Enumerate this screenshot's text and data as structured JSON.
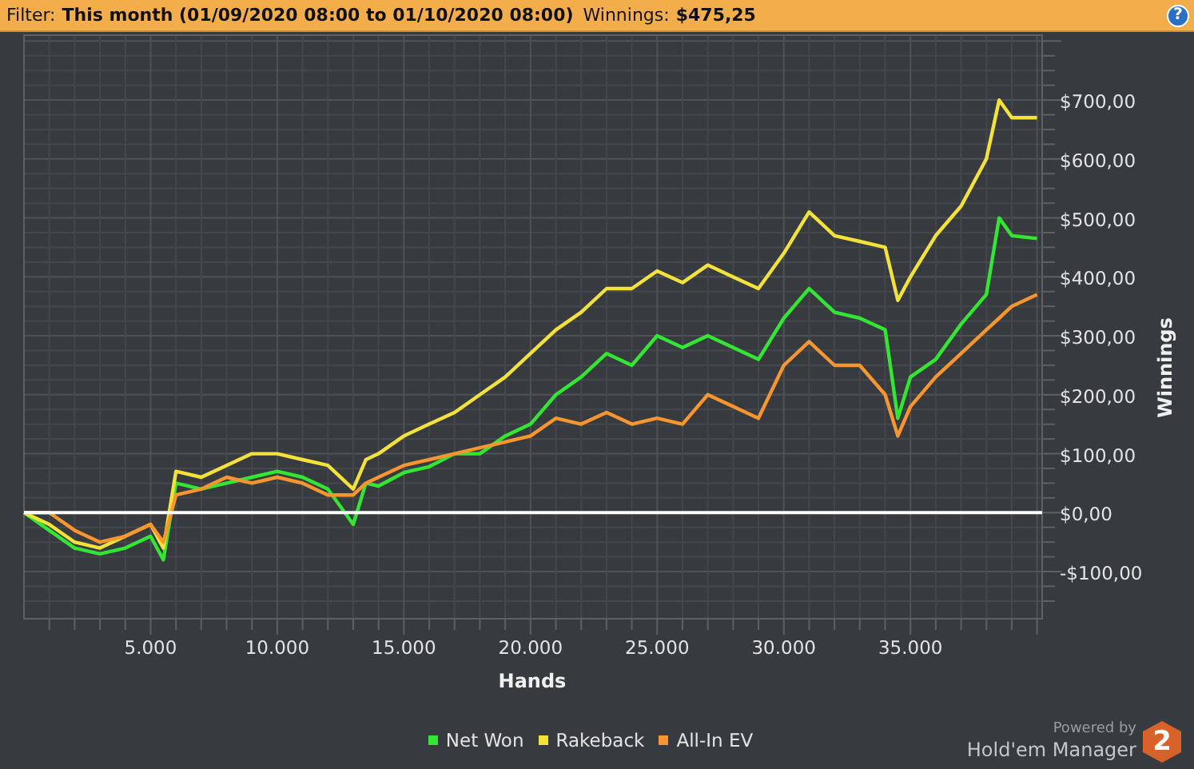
{
  "filter_bar": {
    "items": [
      {
        "label": "Filter:",
        "value": "This month (01/09/2020 08:00 to 01/10/2020 08:00)"
      },
      {
        "label": "Winnings:",
        "value": "$475,25"
      }
    ],
    "help": "?"
  },
  "chart": {
    "chart_data": {
      "type": "line",
      "grid": true,
      "xlabel": "Hands",
      "ylabel": "Winnings",
      "x": [
        0,
        1000,
        2000,
        3000,
        4000,
        5000,
        5500,
        6000,
        7000,
        8000,
        9000,
        10000,
        11000,
        12000,
        13000,
        13500,
        14000,
        15000,
        16000,
        17000,
        18000,
        19000,
        20000,
        21000,
        22000,
        23000,
        24000,
        25000,
        26000,
        27000,
        28000,
        29000,
        30000,
        31000,
        32000,
        33000,
        34000,
        34500,
        35000,
        36000,
        37000,
        38000,
        38500,
        39000,
        40000
      ],
      "series": [
        {
          "name": "Net Won",
          "color": "#33e633",
          "values": [
            0,
            -30,
            -60,
            -70,
            -60,
            -40,
            -80,
            50,
            40,
            50,
            60,
            70,
            60,
            40,
            -20,
            50,
            45,
            68,
            78,
            100,
            100,
            130,
            150,
            200,
            230,
            270,
            250,
            300,
            280,
            300,
            280,
            260,
            330,
            380,
            340,
            330,
            310,
            160,
            230,
            260,
            320,
            370,
            500,
            470,
            465
          ]
        },
        {
          "name": "Rakeback",
          "color": "#f2e23a",
          "values": [
            0,
            -20,
            -50,
            -60,
            -40,
            -20,
            -60,
            70,
            60,
            80,
            100,
            100,
            90,
            80,
            40,
            90,
            100,
            130,
            150,
            170,
            200,
            230,
            270,
            310,
            340,
            380,
            380,
            410,
            390,
            420,
            400,
            380,
            440,
            510,
            470,
            460,
            450,
            360,
            400,
            470,
            520,
            600,
            700,
            670,
            670
          ]
        },
        {
          "name": "All-In EV",
          "color": "#f7962e",
          "values": [
            0,
            0,
            -30,
            -50,
            -40,
            -20,
            -50,
            30,
            40,
            60,
            50,
            60,
            50,
            30,
            30,
            50,
            60,
            80,
            90,
            100,
            110,
            120,
            130,
            160,
            150,
            170,
            150,
            160,
            150,
            200,
            180,
            160,
            250,
            290,
            250,
            250,
            200,
            130,
            180,
            230,
            270,
            310,
            330,
            350,
            370
          ]
        }
      ],
      "xlim": [
        0,
        40200
      ],
      "ylim": [
        -180,
        810
      ],
      "xticks": [
        {
          "value": 5000,
          "label": "5.000"
        },
        {
          "value": 10000,
          "label": "10.000"
        },
        {
          "value": 15000,
          "label": "15.000"
        },
        {
          "value": 20000,
          "label": "20.000"
        },
        {
          "value": 25000,
          "label": "25.000"
        },
        {
          "value": 30000,
          "label": "30.000"
        },
        {
          "value": 35000,
          "label": "35.000"
        }
      ],
      "yticks": [
        {
          "value": -100,
          "label": "-$100,00"
        },
        {
          "value": 0,
          "label": "$0,00"
        },
        {
          "value": 100,
          "label": "$100,00"
        },
        {
          "value": 200,
          "label": "$200,00"
        },
        {
          "value": 300,
          "label": "$300,00"
        },
        {
          "value": 400,
          "label": "$400,00"
        },
        {
          "value": 500,
          "label": "$500,00"
        },
        {
          "value": 600,
          "label": "$600,00"
        },
        {
          "value": 700,
          "label": "$700,00"
        }
      ]
    }
  },
  "branding": {
    "caption": "Powered by",
    "name": "Hold'em Manager",
    "logo_mark": "2"
  }
}
